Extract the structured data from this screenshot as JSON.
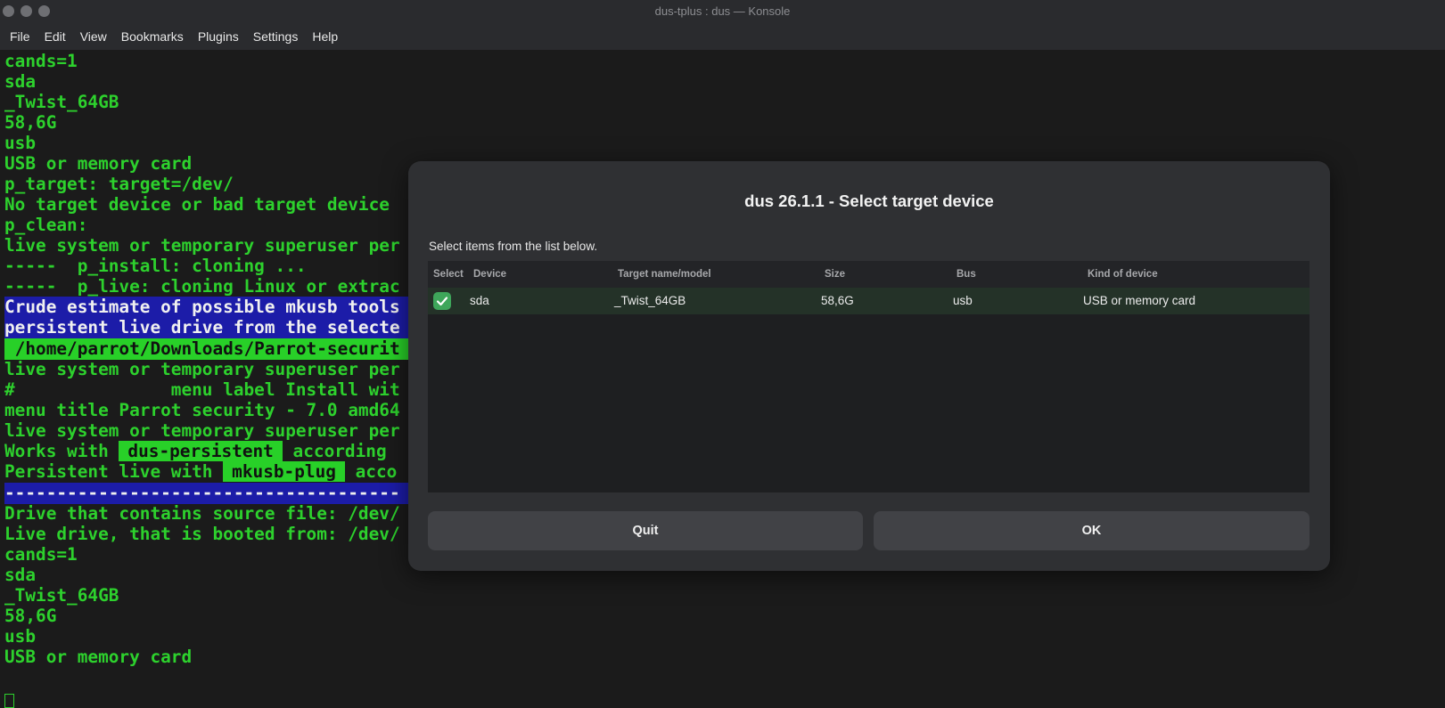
{
  "window": {
    "title": "dus-tplus : dus — Konsole"
  },
  "menu": [
    "File",
    "Edit",
    "View",
    "Bookmarks",
    "Plugins",
    "Settings",
    "Help"
  ],
  "terminal": {
    "lines": [
      "cands=1",
      "sda",
      "_Twist_64GB",
      "58,6G",
      "usb",
      "USB or memory card",
      "p_target: target=/dev/",
      "No target device or bad target device",
      "p_clean:",
      "live system or temporary superuser per",
      "-----  p_install: cloning ...",
      "-----  p_live: cloning Linux or extrac",
      "Crude estimate of possible mkusb tools",
      "persistent live drive from the selecte",
      " /home/parrot/Downloads/Parrot-securit",
      "live system or temporary superuser per",
      "#               menu label Install wit",
      "menu title Parrot security - 7.0 amd64",
      "live system or temporary superuser per",
      "Works with ",
      "Persistent live with ",
      "--------------------------------------",
      "Drive that contains source file: /dev/",
      "Live drive, that is booted from: /dev/",
      "cands=1",
      "sda",
      "_Twist_64GB",
      "58,6G",
      "usb",
      "USB or memory card"
    ],
    "tag_persistent": "dus-persistent",
    "tag_plug": "mkusb-plug",
    "tail_persistent": " according",
    "tail_plug": " acco"
  },
  "dialog": {
    "title": "dus 26.1.1 - Select target device",
    "prompt": "Select items from the list below.",
    "columns": [
      "Select",
      "Device",
      "Target name/model",
      "Size",
      "Bus",
      "Kind of device"
    ],
    "rows": [
      {
        "selected": true,
        "device": "sda",
        "model": "_Twist_64GB",
        "size": "58,6G",
        "bus": "usb",
        "kind": "USB or memory card"
      }
    ],
    "buttons": {
      "quit": "Quit",
      "ok": "OK"
    }
  },
  "colors": {
    "terminal_green": "#2dd12d",
    "highlight_blue": "#1c1ca8",
    "check_green": "#3ea65a"
  }
}
